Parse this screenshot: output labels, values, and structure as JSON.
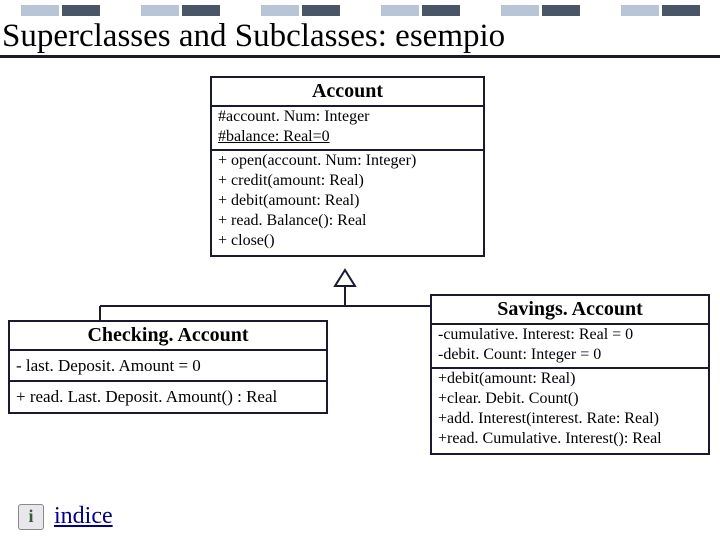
{
  "title": "Superclasses and Subclasses: esempio",
  "account": {
    "name": "Account",
    "attrs": [
      "#account. Num: Integer",
      "#balance: Real=0"
    ],
    "ops": [
      "+ open(account. Num: Integer)",
      "+ credit(amount: Real)",
      "+ debit(amount: Real)",
      "+ read. Balance(): Real",
      "+ close()"
    ]
  },
  "checking": {
    "name": "Checking. Account",
    "attrs": [
      "- last. Deposit. Amount = 0"
    ],
    "ops": [
      "+ read. Last. Deposit. Amount() : Real"
    ]
  },
  "savings": {
    "name": "Savings. Account",
    "attrs": [
      "-cumulative. Interest: Real = 0",
      "-debit. Count: Integer = 0"
    ],
    "ops": [
      "+debit(amount: Real)",
      "+clear. Debit. Count()",
      "+add. Interest(interest. Rate: Real)",
      "+read. Cumulative. Interest(): Real"
    ]
  },
  "footer_link": "indice"
}
